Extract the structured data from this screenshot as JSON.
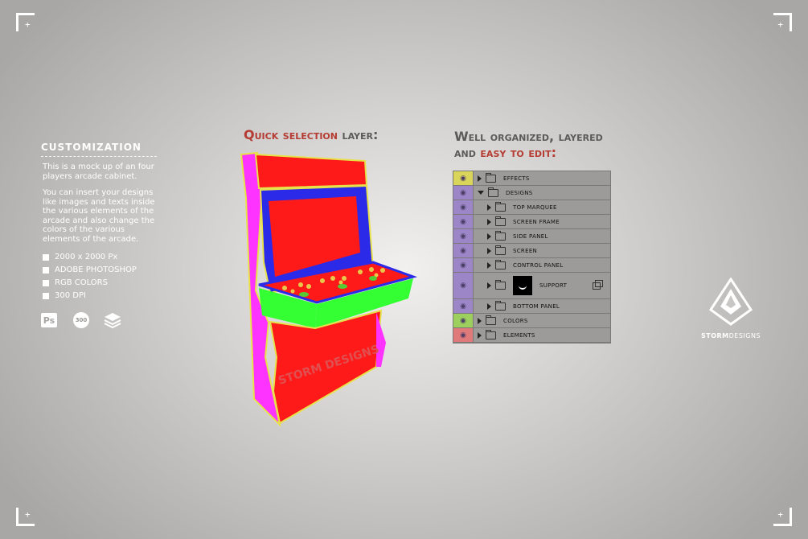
{
  "left": {
    "title": "CUSTOMIZATION",
    "para1": "This is a mock up of an four players arcade cabinet.",
    "para2": "You can insert your designs like images and texts inside the various elements of the arcade and also change the colors of the various elements of the arcade.",
    "features": [
      "2000 x 2000 Px",
      "ADOBE PHOTOSHOP",
      "RGB COLORS",
      "300 DPI"
    ],
    "ps_icon": "Ps",
    "dpi_icon": "300"
  },
  "heading1": {
    "hl": "Quick selection",
    "rest": " layer:"
  },
  "heading2": {
    "line1": "Well organized, layered",
    "line2_a": "and ",
    "line2_hl": "easy to edit:"
  },
  "cabinet_watermark": "STORM DESIGNS",
  "layers": [
    {
      "label": "EFFECTS",
      "eye_color": "#d9d45a",
      "indent": 0,
      "open": false
    },
    {
      "label": "DESIGNS",
      "eye_color": "#9d86c7",
      "indent": 0,
      "open": true
    },
    {
      "label": "TOP MARQUEE",
      "eye_color": "#9d86c7",
      "indent": 1,
      "open": false
    },
    {
      "label": "SCREEN FRAME",
      "eye_color": "#9d86c7",
      "indent": 1,
      "open": false
    },
    {
      "label": "SIDE PANEL",
      "eye_color": "#9d86c7",
      "indent": 1,
      "open": false
    },
    {
      "label": "SCREEN",
      "eye_color": "#9d86c7",
      "indent": 1,
      "open": false
    },
    {
      "label": "CONTROL PANEL",
      "eye_color": "#9d86c7",
      "indent": 1,
      "open": false
    },
    {
      "label": "SUPPORT",
      "eye_color": "#9d86c7",
      "indent": 1,
      "open": false,
      "thumb": true
    },
    {
      "label": "BOTTOM PANEL",
      "eye_color": "#9d86c7",
      "indent": 1,
      "open": false
    },
    {
      "label": "COLORS",
      "eye_color": "#9ccf5e",
      "indent": 0,
      "open": false
    },
    {
      "label": "ELEMENTS",
      "eye_color": "#e07a7a",
      "indent": 0,
      "open": false
    }
  ],
  "logo": {
    "brand_bold": "STORM",
    "brand_rest": "DESIGNS"
  },
  "colors": {
    "accent_red": "#b53c33",
    "heading_gray": "#5b5b5b"
  }
}
